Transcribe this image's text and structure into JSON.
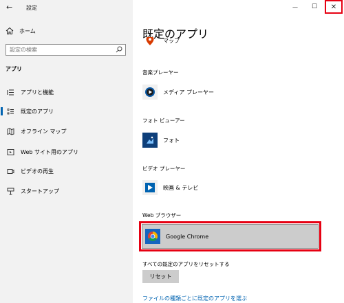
{
  "window": {
    "title": "設定",
    "back_glyph": "←",
    "minimize_glyph": "—",
    "maximize_glyph": "☐",
    "close_glyph": "✕"
  },
  "sidebar": {
    "home_label": "ホーム",
    "search_placeholder": "設定の検索",
    "section_title": "アプリ",
    "items": [
      {
        "label": "アプリと機能",
        "icon": "apps-list-icon"
      },
      {
        "label": "既定のアプリ",
        "icon": "default-apps-icon",
        "active": true
      },
      {
        "label": "オフライン マップ",
        "icon": "offline-map-icon"
      },
      {
        "label": "Web サイト用のアプリ",
        "icon": "website-apps-icon"
      },
      {
        "label": "ビデオの再生",
        "icon": "video-playback-icon"
      },
      {
        "label": "スタートアップ",
        "icon": "startup-icon"
      }
    ]
  },
  "main": {
    "title": "既定のアプリ",
    "partial_app": {
      "name": "マップ",
      "icon": "maps-icon"
    },
    "categories": [
      {
        "label": "音楽プレーヤー",
        "app": "メディア プレーヤー",
        "icon": "media-player-icon"
      },
      {
        "label": "フォト ビューアー",
        "app": "フォト",
        "icon": "photos-icon"
      },
      {
        "label": "ビデオ プレーヤー",
        "app": "映画 & テレビ",
        "icon": "movies-tv-icon"
      }
    ],
    "web_browser": {
      "label": "Web ブラウザー",
      "app": "Google Chrome",
      "icon": "chrome-icon"
    },
    "reset_label": "すべての既定のアプリをリセットする",
    "reset_button": "リセット",
    "link": "ファイルの種類ごとに既定のアプリを選ぶ"
  },
  "colors": {
    "accent": "#0063b1",
    "highlight_border": "#e60012",
    "sidebar_bg": "#f2f2f2",
    "selected_bg": "#cccccc"
  }
}
